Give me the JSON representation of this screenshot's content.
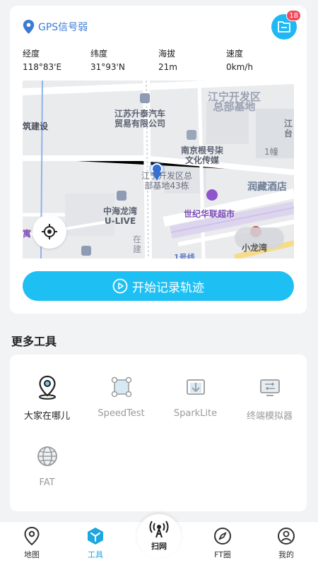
{
  "gps": {
    "status": "GPS信号弱"
  },
  "files": {
    "badge_count": "18"
  },
  "stats": [
    {
      "label": "经度",
      "value": "118°83'E"
    },
    {
      "label": "纬度",
      "value": "31°93'N"
    },
    {
      "label": "海拔",
      "value": "21m"
    },
    {
      "label": "速度",
      "value": "0km/h"
    }
  ],
  "map": {
    "labels": {
      "jiangning_dev": "江宁开发区\n总部基地",
      "jiangsu_auto": "江苏升泰汽车\n贸易有限公司",
      "zhu_jianshe": "筑建设",
      "jiang_right": "江\n台",
      "nanjing_media": "南京根号柒\n文化传媒",
      "building1": "1幢",
      "hq43": "江宁开发区总\n部基地43栋",
      "runcang_hotel": "润藏酒店",
      "century_market": "世纪华联超市",
      "zhonghai": "中海龙湾\nU-LIVE",
      "zai": "在",
      "jian": "建",
      "yu": "寓",
      "xiaolongwan": "小龙湾",
      "line1": "1号线"
    }
  },
  "start_record": {
    "label": "开始记录轨迹"
  },
  "more_tools": {
    "title": "更多工具"
  },
  "tools": [
    {
      "label": "大家在哪儿",
      "icon": "location-pin-icon"
    },
    {
      "label": "SpeedTest",
      "icon": "speedtest-icon"
    },
    {
      "label": "SparkLite",
      "icon": "sparklite-icon"
    },
    {
      "label": "终端模拟器",
      "icon": "terminal-simulator-icon"
    },
    {
      "label": "FAT",
      "icon": "globe-icon"
    }
  ],
  "tabs": [
    {
      "label": "地图",
      "icon": "map-pin-icon"
    },
    {
      "label": "工具",
      "icon": "cube-icon"
    },
    {
      "label": "扫网",
      "icon": "antenna-icon"
    },
    {
      "label": "FT圈",
      "icon": "compass-icon"
    },
    {
      "label": "我的",
      "icon": "user-icon"
    }
  ],
  "colors": {
    "accent": "#1ec0f4",
    "badge": "#f04a5b",
    "gps_text": "#3a7bd5"
  }
}
